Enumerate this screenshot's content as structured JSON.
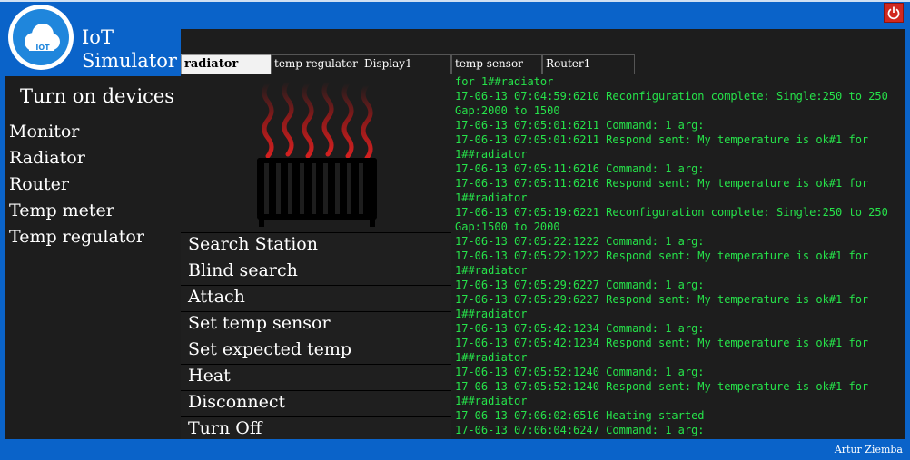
{
  "app": {
    "logo_text": "IOT",
    "title_line1": "IoT",
    "title_line2": "Simulator",
    "author": "Artur Ziemba",
    "accent": "#0a63c9"
  },
  "sidebar": {
    "heading": "Turn on devices",
    "items": [
      {
        "label": "Monitor"
      },
      {
        "label": "Radiator"
      },
      {
        "label": "Router"
      },
      {
        "label": "Temp meter"
      },
      {
        "label": "Temp regulator"
      }
    ]
  },
  "tabs": [
    {
      "label": "radiator",
      "active": true
    },
    {
      "label": "temp regulator",
      "active": false
    },
    {
      "label": "Display1",
      "active": false
    },
    {
      "label": "temp sensor",
      "active": false
    },
    {
      "label": "Router1",
      "active": false
    }
  ],
  "actions": [
    {
      "label": "Search Station"
    },
    {
      "label": "Blind search"
    },
    {
      "label": "Attach"
    },
    {
      "label": "Set temp sensor"
    },
    {
      "label": "Set expected temp"
    },
    {
      "label": "Heat"
    },
    {
      "label": "Disconnect"
    },
    {
      "label": "Turn Off"
    }
  ],
  "log": {
    "color": "#26e34a",
    "lines": [
      "for 1##radiator",
      "17-06-13 07:04:59:6210 Reconfiguration complete: Single:250 to 250 Gap:2000 to 1500",
      "17-06-13 07:05:01:6211 Command: 1 arg:",
      "17-06-13 07:05:01:6211 Respond sent: My temperature is ok#1 for 1##radiator",
      "17-06-13 07:05:11:6216 Command: 1 arg:",
      "17-06-13 07:05:11:6216 Respond sent: My temperature is ok#1 for 1##radiator",
      "17-06-13 07:05:19:6221 Reconfiguration complete: Single:250 to 250 Gap:1500 to 2000",
      "17-06-13 07:05:22:1222 Command: 1 arg:",
      "17-06-13 07:05:22:1222 Respond sent: My temperature is ok#1 for 1##radiator",
      "17-06-13 07:05:29:6227 Command: 1 arg:",
      "17-06-13 07:05:29:6227 Respond sent: My temperature is ok#1 for 1##radiator",
      "17-06-13 07:05:42:1234 Command: 1 arg:",
      "17-06-13 07:05:42:1234 Respond sent: My temperature is ok#1 for 1##radiator",
      "17-06-13 07:05:52:1240 Command: 1 arg:",
      "17-06-13 07:05:52:1240 Respond sent: My temperature is ok#1 for 1##radiator",
      "17-06-13 07:06:02:6516 Heating started",
      "17-06-13 07:06:04:6247 Command: 1 arg:"
    ]
  },
  "icons": {
    "power": "power-icon",
    "logo": "cloud-icon",
    "radiator": "radiator-heating-icon"
  }
}
